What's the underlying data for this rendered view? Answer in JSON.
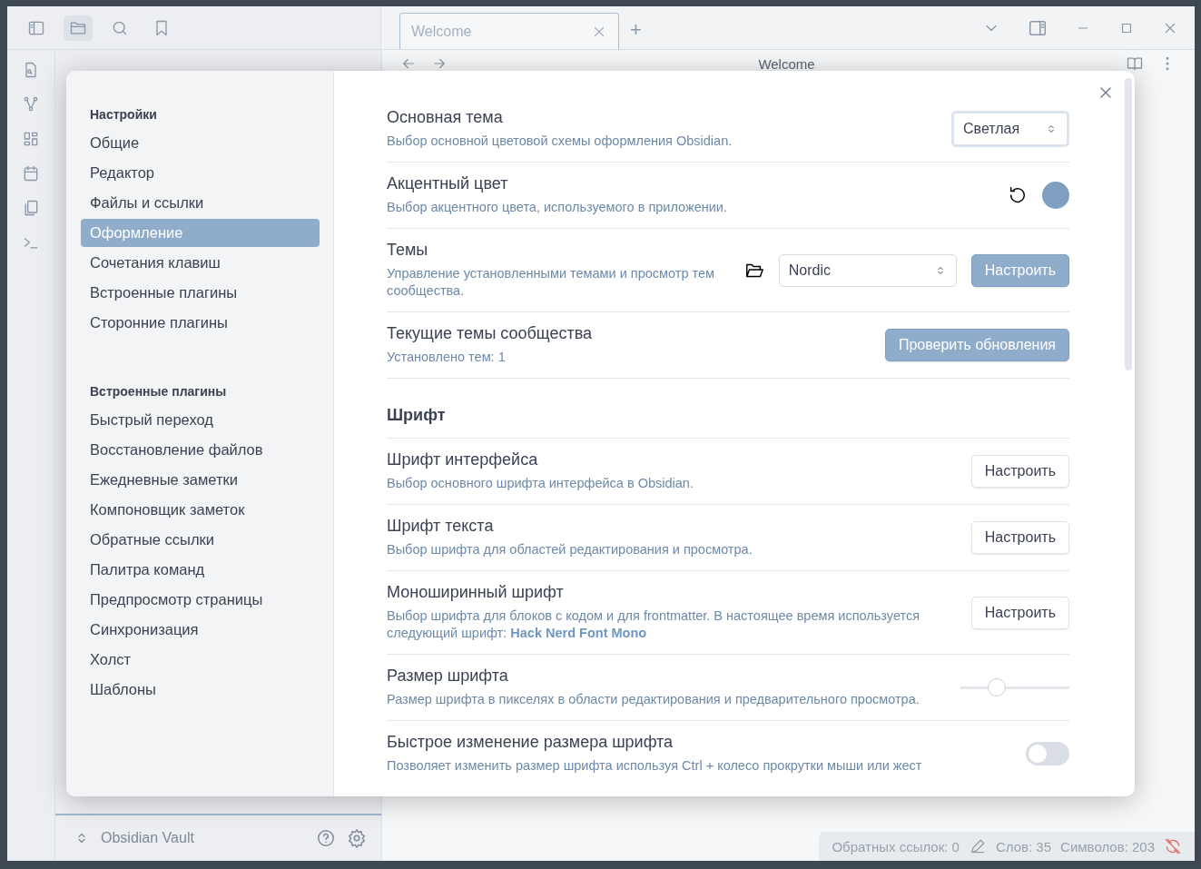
{
  "window": {
    "tabs": [
      {
        "title": "Welcome",
        "selected": true
      }
    ],
    "new_tab": "+",
    "view_title": "Welcome"
  },
  "vault": {
    "name": "Obsidian Vault"
  },
  "status_bar": {
    "backlinks": "Обратных ссылок: 0",
    "words": "Слов: 35",
    "chars": "Символов: 203"
  },
  "settings": {
    "nav": [
      {
        "heading": "Настройки",
        "items": [
          {
            "label": "Общие",
            "selected": false
          },
          {
            "label": "Редактор",
            "selected": false
          },
          {
            "label": "Файлы и ссылки",
            "selected": false
          },
          {
            "label": "Оформление",
            "selected": true
          },
          {
            "label": "Сочетания клавиш",
            "selected": false
          },
          {
            "label": "Встроенные плагины",
            "selected": false
          },
          {
            "label": "Сторонние плагины",
            "selected": false
          }
        ]
      },
      {
        "heading": "Встроенные плагины",
        "items": [
          {
            "label": "Быстрый переход",
            "selected": false
          },
          {
            "label": "Восстановление файлов",
            "selected": false
          },
          {
            "label": "Ежедневные заметки",
            "selected": false
          },
          {
            "label": "Компоновщик заметок",
            "selected": false
          },
          {
            "label": "Обратные ссылки",
            "selected": false
          },
          {
            "label": "Палитра команд",
            "selected": false
          },
          {
            "label": "Предпросмотр страницы",
            "selected": false
          },
          {
            "label": "Синхронизация",
            "selected": false
          },
          {
            "label": "Холст",
            "selected": false
          },
          {
            "label": "Шаблоны",
            "selected": false
          }
        ]
      }
    ],
    "items": [
      {
        "kind": "dropdown",
        "name": "Основная тема",
        "desc": "Выбор основной цветовой схемы оформления Obsidian.",
        "value": "Светлая"
      },
      {
        "kind": "color",
        "name": "Акцентный цвет",
        "desc": "Выбор акцентного цвета, используемого в приложении.",
        "color": "#7f9fc1"
      },
      {
        "kind": "theme",
        "name": "Темы",
        "desc": "Управление установленными темами и просмотр тем сообщества.",
        "value": "Nordic",
        "button": "Настроить",
        "accent": true
      },
      {
        "kind": "button",
        "name": "Текущие темы сообщества",
        "desc": "Установлено тем: 1",
        "button": "Проверить обновления",
        "accent": true
      },
      {
        "kind": "heading",
        "name": "Шрифт"
      },
      {
        "kind": "button",
        "name": "Шрифт интерфейса",
        "desc": "Выбор основного шрифта интерфейса в Obsidian.",
        "button": "Настроить",
        "accent": false
      },
      {
        "kind": "button",
        "name": "Шрифт текста",
        "desc": "Выбор шрифта для областей редактирования и просмотра.",
        "button": "Настроить",
        "accent": false
      },
      {
        "kind": "button",
        "name": "Моноширинный шрифт",
        "desc": "Выбор шрифта для блоков с кодом и для frontmatter. В настоящее время используется следующий шрифт:",
        "desc_link": "Hack Nerd Font Mono",
        "button": "Настроить",
        "accent": false
      },
      {
        "kind": "slider",
        "name": "Размер шрифта",
        "desc": "Размер шрифта в пикселях в области редактирования и предварительного просмотра.",
        "level": 0.33
      },
      {
        "kind": "toggle",
        "name": "Быстрое изменение размера шрифта",
        "desc": "Позволяет изменить размер шрифта используя Ctrl + колесо прокрутки мыши или жест",
        "on": false
      }
    ]
  }
}
